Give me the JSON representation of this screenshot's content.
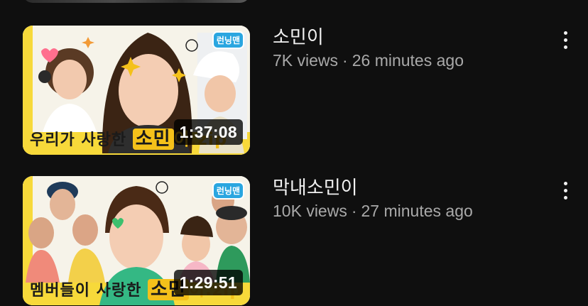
{
  "videos": [
    {
      "title": "소민이",
      "views": "7K views",
      "separator": "·",
      "age": "26 minutes ago",
      "duration": "1:37:08",
      "thumbnail": {
        "caption_prefix": "우리가 사랑한 ",
        "caption_highlight": "소민",
        "caption_suffix": "이.zip",
        "badge": "런닝맨"
      }
    },
    {
      "title": "막내소민이",
      "views": "10K views",
      "separator": "·",
      "age": "27 minutes ago",
      "duration": "1:29:51",
      "thumbnail": {
        "caption_prefix": "멤버들이 사랑한 ",
        "caption_highlight": "소민",
        "caption_suffix": "이.zip",
        "badge": "런닝맨"
      }
    }
  ],
  "colors": {
    "background": "#0f0f0f",
    "title": "#f1f1f1",
    "subtext": "#a9a9a9",
    "thumb_accent": "#f4c11a",
    "badge": "#2aa6e0"
  },
  "icons": [
    "more-vert-icon",
    "sparkle-icon",
    "heart-icon",
    "smiley-icon"
  ]
}
